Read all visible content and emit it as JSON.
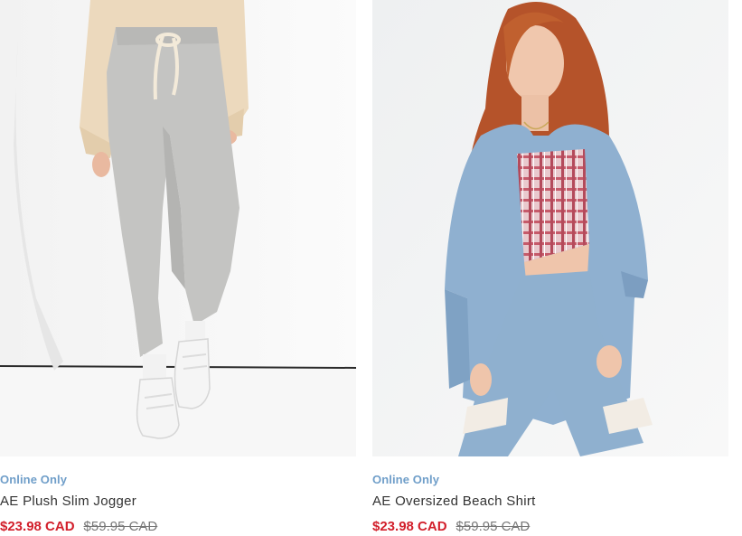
{
  "products": [
    {
      "badge": "Online Only",
      "name": "AE Plush Slim Jogger",
      "sale_price": "$23.98 CAD",
      "original_price": "$59.95 CAD",
      "image_alt": "model wearing grey jogger pants and white sneakers"
    },
    {
      "badge": "Online Only",
      "name": "AE Oversized Beach Shirt",
      "sale_price": "$23.98 CAD",
      "original_price": "$59.95 CAD",
      "image_alt": "model wearing oversized chambray shirt and plaid top"
    }
  ],
  "colors": {
    "badge": "#6f9ec9",
    "sale_price": "#d21f2b",
    "original_price": "#777777",
    "name": "#333333"
  }
}
